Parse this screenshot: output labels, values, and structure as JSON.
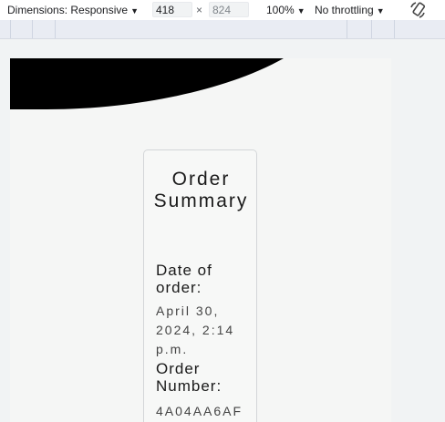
{
  "devtools": {
    "dimensions_label": "Dimensions: Responsive",
    "width": "418",
    "height": "824",
    "times": "×",
    "zoom": "100%",
    "throttling": "No throttling",
    "caret": "▼"
  },
  "page": {
    "title": "Order Summary",
    "date_label": "Date of order:",
    "date_value": "April 30, 2024, 2:14 p.m.",
    "order_number_label": "Order Number:",
    "order_number_value": "4A04AA6AF"
  },
  "icons": {
    "rotate": "rotate-icon"
  }
}
